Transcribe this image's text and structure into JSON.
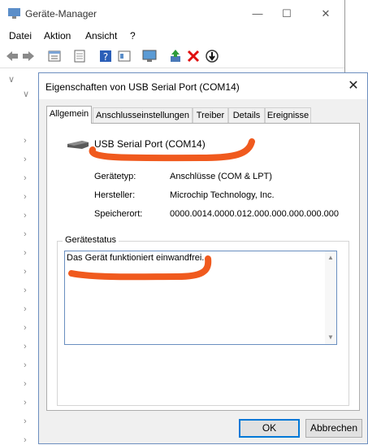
{
  "device_manager": {
    "title": "Geräte-Manager",
    "window_controls": {
      "minimize": "—",
      "maximize": "☐",
      "close": "✕"
    },
    "menu": [
      "Datei",
      "Aktion",
      "Ansicht",
      "?"
    ],
    "toolbar_icons": [
      "back-icon",
      "forward-icon",
      "properties-list-icon",
      "document-icon",
      "help-icon",
      "view-icon",
      "monitor-icon",
      "update-driver-icon",
      "uninstall-icon",
      "download-icon"
    ]
  },
  "dialog": {
    "title": "Eigenschaften von USB Serial Port (COM14)",
    "close": "✕",
    "tabs": [
      "Allgemein",
      "Anschlusseinstellungen",
      "Treiber",
      "Details",
      "Ereignisse"
    ],
    "active_tab": "Allgemein",
    "device_name": "USB Serial Port (COM14)",
    "properties": [
      {
        "label": "Gerätetyp:",
        "value": "Anschlüsse (COM & LPT)"
      },
      {
        "label": "Hersteller:",
        "value": "Microchip Technology, Inc."
      },
      {
        "label": "Speicherort:",
        "value": "0000.0014.0000.012.000.000.000.000.000"
      }
    ],
    "status_group_label": "Gerätestatus",
    "status_text": "Das Gerät funktioniert einwandfrei.",
    "buttons": {
      "ok": "OK",
      "cancel": "Abbrechen"
    },
    "annotation_color": "#f05a1e"
  }
}
